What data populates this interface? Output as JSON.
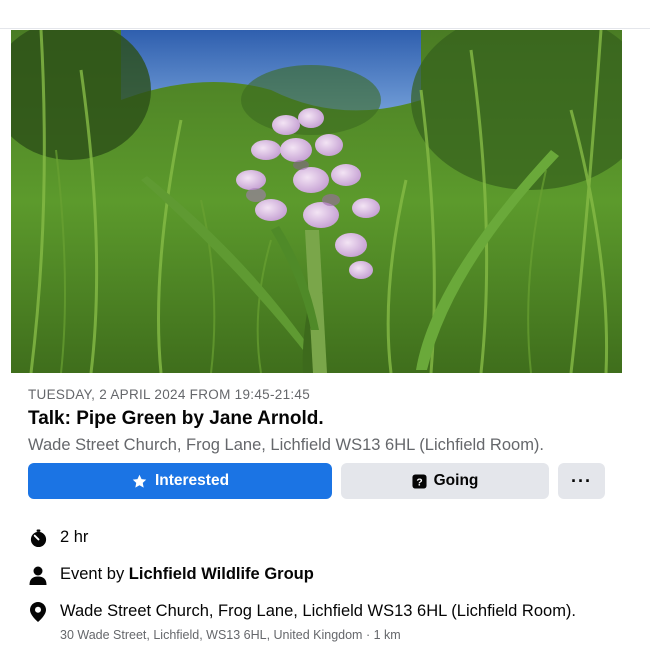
{
  "event": {
    "date_line": "TUESDAY, 2 APRIL 2024 FROM 19:45-21:45",
    "title": "Talk:  Pipe Green by Jane Arnold.",
    "location_line": "Wade Street Church, Frog Lane, Lichfield WS13 6HL (Lichfield Room)."
  },
  "actions": {
    "interested_label": "Interested",
    "going_label": "Going",
    "more_label": "···"
  },
  "details": {
    "duration": "2 hr",
    "host_prefix": "Event by ",
    "host_name": "Lichfield Wildlife Group",
    "location_name": "Wade Street Church, Frog Lane, Lichfield WS13 6HL (Lichfield Room).",
    "address": "30 Wade Street, Lichfield, WS13 6HL, United Kingdom · 1 km"
  },
  "icons": {
    "interested": "star-icon",
    "going": "question-box-icon",
    "duration": "stopwatch-icon",
    "host": "person-icon",
    "location": "map-pin-icon"
  },
  "colors": {
    "primary": "#1b74e4",
    "secondary_button": "#e4e6eb",
    "muted_text": "#65676b"
  }
}
